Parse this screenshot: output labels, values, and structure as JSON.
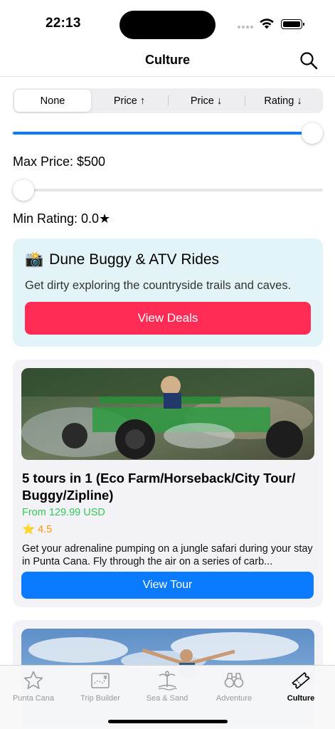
{
  "status_bar": {
    "time": "22:13"
  },
  "nav": {
    "title": "Culture"
  },
  "sort": {
    "options": [
      "None",
      "Price ↑",
      "Price ↓",
      "Rating ↓"
    ],
    "selected": "None"
  },
  "filters": {
    "max_price_label": "Max Price: $500",
    "max_price_fraction": 1.0,
    "min_rating_label": "Min Rating: 0.0★",
    "min_rating_fraction": 0.0
  },
  "promo": {
    "emoji": "📸",
    "title": "Dune Buggy & ATV Rides",
    "description": "Get dirty exploring the countryside trails and caves.",
    "button_label": "View Deals"
  },
  "tours": [
    {
      "title": "5 tours in 1 (Eco Farm/Horseback/City Tour/ Buggy/Zipline)",
      "price": "From 129.99 USD",
      "rating": "4.5",
      "description": "Get your adrenaline pumping on a jungle safari during your stay in Punta Cana. Fly through the air on a series of carb...",
      "button_label": "View Tour"
    }
  ],
  "tab_bar": {
    "tabs": [
      {
        "label": "Punta Cana",
        "icon": "star-icon"
      },
      {
        "label": "Trip Builder",
        "icon": "map-icon"
      },
      {
        "label": "Sea & Sand",
        "icon": "beach-icon"
      },
      {
        "label": "Adventure",
        "icon": "binoculars-icon"
      },
      {
        "label": "Culture",
        "icon": "ticket-icon"
      }
    ],
    "active": "Culture"
  },
  "colors": {
    "accent": "#0a7aff",
    "promo_button": "#ff2d55",
    "promo_bg": "#e2f4f7",
    "price": "#34c759",
    "rating": "#ff9500"
  }
}
